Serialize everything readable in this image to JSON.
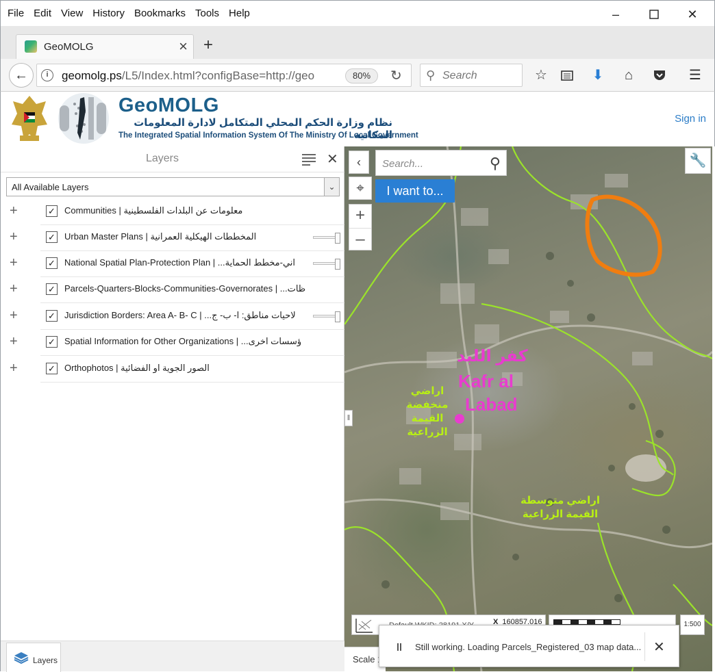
{
  "browser": {
    "menu": [
      "File",
      "Edit",
      "View",
      "History",
      "Bookmarks",
      "Tools",
      "Help"
    ],
    "tab_title": "GeoMOLG",
    "url_domain": "geomolg.ps",
    "url_path": "/L5/Index.html?configBase=http://geo",
    "zoom": "80%",
    "search_placeholder": "Search"
  },
  "header": {
    "title": "GeoMOLG",
    "subtitle_ar": "نظام وزارة الحكم المحلي المتكامل لادارة المعلومات المكانية",
    "subtitle_en": "The Integrated Spatial Information System Of The Ministry Of Local Government",
    "sign_in": "Sign in"
  },
  "layers_panel": {
    "title": "Layers",
    "filter": "All Available Layers",
    "layers": [
      {
        "name": "Communities | معلومات عن البلدات الفلسطينية",
        "checked": true,
        "slider": false
      },
      {
        "name": "Urban Master Plans | المخططات الهيكلية العمرانية",
        "checked": true,
        "slider": true
      },
      {
        "name": "National Spatial Plan-Protection Plan | ...اني-مخطط الحماية",
        "checked": true,
        "slider": true
      },
      {
        "name": "Parcels-Quarters-Blocks-Communities-Governorates | ...ظات",
        "checked": true,
        "slider": false
      },
      {
        "name": "Jurisdiction Borders: Area A- B- C | ...لاحيات مناطق: ا- ب- ج",
        "checked": true,
        "slider": true
      },
      {
        "name": "Spatial Information for Other Organizations | ...ؤسسات اخرى",
        "checked": true,
        "slider": false
      },
      {
        "name": "Orthophotos | الصور الجوية او الفضائية",
        "checked": true,
        "slider": false
      }
    ],
    "footer_tab": "Layers"
  },
  "map": {
    "search_placeholder": "Search...",
    "i_want_to": "I want to...",
    "town_ar": "كفر اللبد",
    "town_en_line1": "Kafr al",
    "town_en_line2": "Labad",
    "label_green_1": "اراضي منخفضة القيمة الزراعية",
    "label_green_2": "اراضي متوسطة القيمة الزراعية",
    "projection": "Default WKID: 28191 X/Y",
    "x_label": "X",
    "x_value": "160857.016",
    "scale_label": "Scale 1",
    "scale_button": "1:500",
    "loading_message": "Still working. Loading Parcels_Registered_03 map data...",
    "colors": {
      "boundary": "#9be32a",
      "highlight": "#f07d10",
      "town": "#e83ccf"
    }
  }
}
